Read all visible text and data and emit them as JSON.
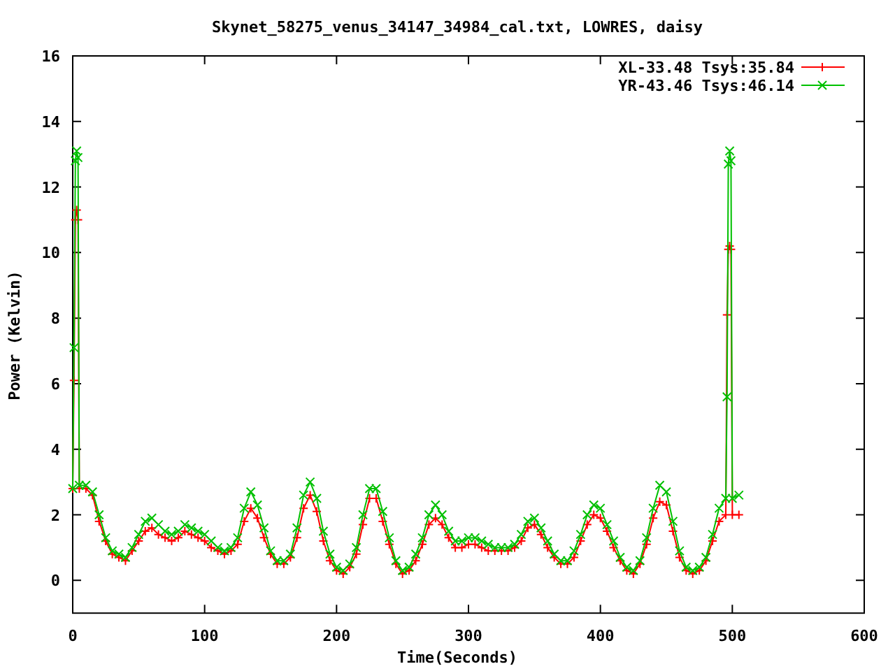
{
  "chart_data": {
    "type": "line",
    "title": "Skynet_58275_venus_34147_34984_cal.txt, LOWRES, daisy",
    "xlabel": "Time(Seconds)",
    "ylabel": "Power (Kelvin)",
    "xlim": [
      0,
      600
    ],
    "ylim": [
      -1,
      16
    ],
    "xticks": [
      0,
      100,
      200,
      300,
      400,
      500,
      600
    ],
    "yticks": [
      0,
      2,
      4,
      6,
      8,
      10,
      12,
      14,
      16
    ],
    "legend": "top right",
    "x": [
      0,
      1,
      2,
      3,
      4,
      5,
      10,
      15,
      20,
      25,
      30,
      35,
      40,
      45,
      50,
      55,
      60,
      65,
      70,
      75,
      80,
      85,
      90,
      95,
      100,
      105,
      110,
      115,
      120,
      125,
      130,
      135,
      140,
      145,
      150,
      155,
      160,
      165,
      170,
      175,
      180,
      185,
      190,
      195,
      200,
      205,
      210,
      215,
      220,
      225,
      230,
      235,
      240,
      245,
      250,
      255,
      260,
      265,
      270,
      275,
      280,
      285,
      290,
      295,
      300,
      305,
      310,
      315,
      320,
      325,
      330,
      335,
      340,
      345,
      350,
      355,
      360,
      365,
      370,
      375,
      380,
      385,
      390,
      395,
      400,
      405,
      410,
      415,
      420,
      425,
      430,
      435,
      440,
      445,
      450,
      455,
      460,
      465,
      470,
      475,
      480,
      485,
      490,
      495,
      496,
      497,
      498,
      499,
      500,
      505
    ],
    "series": [
      {
        "name": "XL-33.48 Tsys:35.84",
        "color": "#ff0000",
        "marker": "plus",
        "values": [
          2.8,
          6.1,
          11.0,
          11.3,
          11.0,
          2.8,
          2.8,
          2.6,
          1.8,
          1.2,
          0.8,
          0.7,
          0.6,
          0.9,
          1.2,
          1.5,
          1.6,
          1.4,
          1.3,
          1.2,
          1.3,
          1.5,
          1.4,
          1.3,
          1.2,
          1.0,
          0.9,
          0.8,
          0.9,
          1.1,
          1.8,
          2.2,
          1.9,
          1.3,
          0.8,
          0.5,
          0.5,
          0.7,
          1.3,
          2.2,
          2.6,
          2.1,
          1.2,
          0.6,
          0.3,
          0.2,
          0.4,
          0.8,
          1.7,
          2.5,
          2.5,
          1.8,
          1.1,
          0.5,
          0.2,
          0.3,
          0.6,
          1.1,
          1.7,
          1.9,
          1.7,
          1.3,
          1.0,
          1.0,
          1.1,
          1.1,
          1.0,
          0.9,
          0.9,
          0.9,
          0.9,
          1.0,
          1.2,
          1.6,
          1.7,
          1.4,
          1.0,
          0.7,
          0.5,
          0.5,
          0.7,
          1.2,
          1.7,
          2.0,
          1.9,
          1.5,
          1.0,
          0.6,
          0.3,
          0.2,
          0.5,
          1.1,
          1.9,
          2.4,
          2.3,
          1.5,
          0.7,
          0.3,
          0.2,
          0.3,
          0.6,
          1.2,
          1.8,
          2.0,
          8.1,
          10.1,
          10.2,
          10.1,
          2.0,
          2.0
        ]
      },
      {
        "name": "YR-43.46 Tsys:46.14",
        "color": "#00c000",
        "marker": "cross",
        "values": [
          2.8,
          7.1,
          12.8,
          13.1,
          12.9,
          2.9,
          2.9,
          2.7,
          2.0,
          1.3,
          0.9,
          0.8,
          0.7,
          1.0,
          1.4,
          1.8,
          1.9,
          1.7,
          1.5,
          1.4,
          1.5,
          1.7,
          1.6,
          1.5,
          1.4,
          1.2,
          1.0,
          0.9,
          1.0,
          1.3,
          2.2,
          2.7,
          2.3,
          1.6,
          0.9,
          0.6,
          0.6,
          0.8,
          1.6,
          2.6,
          3.0,
          2.5,
          1.5,
          0.8,
          0.4,
          0.3,
          0.5,
          1.0,
          2.0,
          2.8,
          2.8,
          2.1,
          1.3,
          0.6,
          0.3,
          0.4,
          0.8,
          1.3,
          2.0,
          2.3,
          2.0,
          1.5,
          1.2,
          1.2,
          1.3,
          1.3,
          1.2,
          1.1,
          1.0,
          1.0,
          1.0,
          1.1,
          1.4,
          1.8,
          1.9,
          1.6,
          1.2,
          0.8,
          0.6,
          0.6,
          0.9,
          1.4,
          2.0,
          2.3,
          2.2,
          1.7,
          1.2,
          0.7,
          0.4,
          0.3,
          0.6,
          1.3,
          2.2,
          2.9,
          2.7,
          1.8,
          0.9,
          0.4,
          0.3,
          0.4,
          0.7,
          1.4,
          2.2,
          2.5,
          5.6,
          12.7,
          13.1,
          12.8,
          2.5,
          2.6
        ]
      }
    ]
  }
}
